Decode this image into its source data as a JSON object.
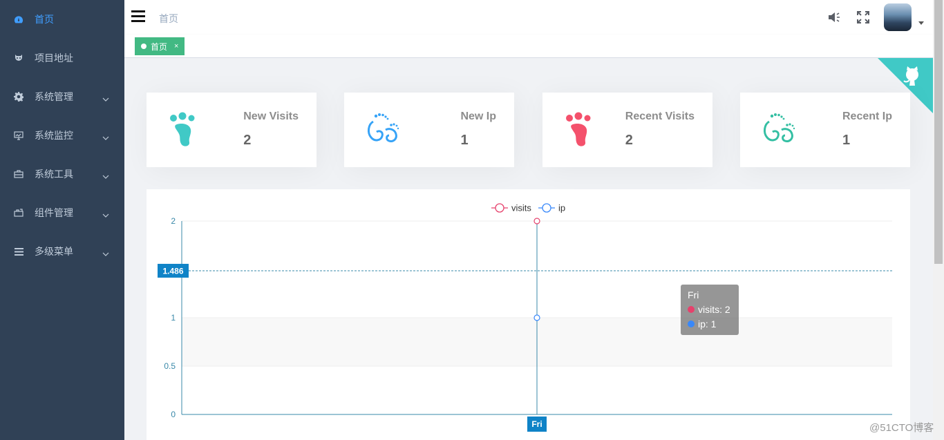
{
  "sidebar": {
    "items": [
      {
        "label": "首页",
        "icon": "dashboard-icon",
        "active": true,
        "has_arrow": false
      },
      {
        "label": "项目地址",
        "icon": "github-icon",
        "active": false,
        "has_arrow": false
      },
      {
        "label": "系统管理",
        "icon": "gear-icon",
        "active": false,
        "has_arrow": true
      },
      {
        "label": "系统监控",
        "icon": "monitor-icon",
        "active": false,
        "has_arrow": true
      },
      {
        "label": "系统工具",
        "icon": "toolbox-icon",
        "active": false,
        "has_arrow": true
      },
      {
        "label": "组件管理",
        "icon": "component-icon",
        "active": false,
        "has_arrow": true
      },
      {
        "label": "多级菜单",
        "icon": "menu-icon",
        "active": false,
        "has_arrow": true
      }
    ]
  },
  "navbar": {
    "breadcrumb": "首页",
    "icons": [
      "speaker-icon",
      "fullscreen-icon"
    ]
  },
  "tags": [
    {
      "label": "首页",
      "active": true,
      "close": "×"
    }
  ],
  "cards": [
    {
      "title": "New Visits",
      "value": "2",
      "icon": "footprint-icon",
      "color": "#40c9c6"
    },
    {
      "title": "New Ip",
      "value": "1",
      "icon": "baby-feet-icon",
      "color": "#36a3f7"
    },
    {
      "title": "Recent Visits",
      "value": "2",
      "icon": "footprint-icon",
      "color": "#f4516c"
    },
    {
      "title": "Recent Ip",
      "value": "1",
      "icon": "baby-feet-icon",
      "color": "#34bfa3"
    }
  ],
  "colors": {
    "sidebar_bg": "#304156",
    "sidebar_active": "#409eff",
    "tag_active": "#42b983",
    "axis": "#3888a8",
    "visits": "#e6416c",
    "ip": "#3888fa",
    "github_corner": "#40c9c6"
  },
  "chart_data": {
    "type": "line",
    "categories": [
      "Fri"
    ],
    "series": [
      {
        "name": "visits",
        "values": [
          2
        ],
        "color": "#e6416c"
      },
      {
        "name": "ip",
        "values": [
          1
        ],
        "color": "#3888fa"
      }
    ],
    "ylim": [
      0,
      2
    ],
    "yticks": [
      0,
      0.5,
      1,
      2
    ],
    "legend_position": "top-center",
    "crosshair": {
      "y_value": 1.486,
      "y_label": "1.486",
      "x_label": "Fri"
    },
    "tooltip": {
      "title": "Fri",
      "rows": [
        {
          "text": "visits: 2",
          "color": "#e6416c"
        },
        {
          "text": "ip: 1",
          "color": "#3888fa"
        }
      ]
    }
  },
  "watermark": "@51CTO博客"
}
